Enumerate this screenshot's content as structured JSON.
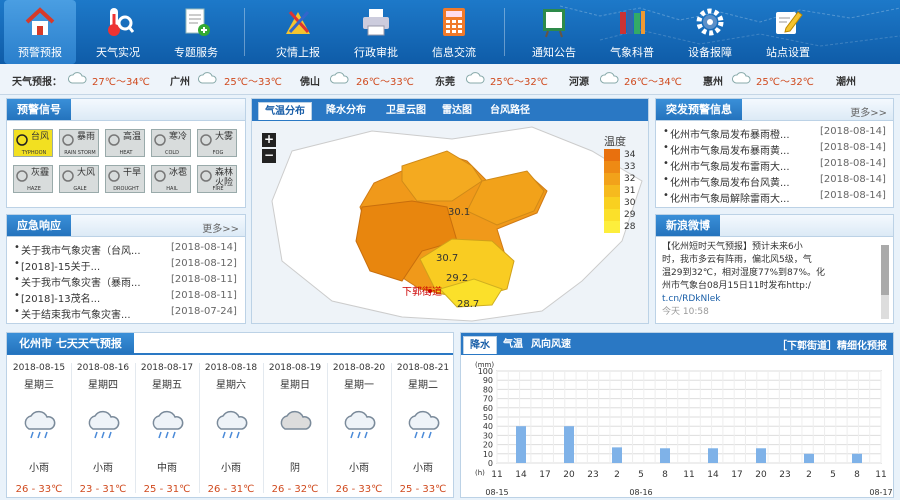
{
  "nav": [
    {
      "label": "预警预报",
      "icon": "home-icon",
      "active": true
    },
    {
      "label": "天气实况",
      "icon": "thermometer-icon",
      "active": false
    },
    {
      "label": "专题服务",
      "icon": "document-icon",
      "active": false
    },
    {
      "label": "灾情上报",
      "icon": "report-icon",
      "active": false
    },
    {
      "label": "行政审批",
      "icon": "printer-icon",
      "active": false
    },
    {
      "label": "信息交流",
      "icon": "calculator-icon",
      "active": false
    },
    {
      "label": "通知公告",
      "icon": "notice-board-icon",
      "active": false
    },
    {
      "label": "气象科普",
      "icon": "books-icon",
      "active": false
    },
    {
      "label": "设备报障",
      "icon": "gear-icon",
      "active": false
    },
    {
      "label": "站点设置",
      "icon": "settings-pen-icon",
      "active": false
    }
  ],
  "ticker": {
    "label": "天气预报：",
    "items": [
      {
        "city": "",
        "temp": "27℃～34℃"
      },
      {
        "city": "广州",
        "temp": "25℃～33℃"
      },
      {
        "city": "佛山",
        "temp": "26℃～33℃"
      },
      {
        "city": "东莞",
        "temp": "25℃～32℃"
      },
      {
        "city": "河源",
        "temp": "26℃～34℃"
      },
      {
        "city": "惠州",
        "temp": "25℃～32℃"
      },
      {
        "city": "潮州",
        "temp": ""
      }
    ]
  },
  "warnings": {
    "title": "预警信号",
    "icons": [
      {
        "name": "typhoon-warning-icon",
        "cn": "台风",
        "en": "TYPHOON",
        "active": true
      },
      {
        "name": "rainstorm-warning-icon",
        "cn": "暴雨",
        "en": "RAIN STORM",
        "active": false
      },
      {
        "name": "heat-warning-icon",
        "cn": "高温",
        "en": "HEAT",
        "active": false
      },
      {
        "name": "cold-warning-icon",
        "cn": "寒冷",
        "en": "COLD",
        "active": false
      },
      {
        "name": "fog-warning-icon",
        "cn": "大雾",
        "en": "FOG",
        "active": false
      },
      {
        "name": "haze-warning-icon",
        "cn": "灰霾",
        "en": "HAZE",
        "active": false
      },
      {
        "name": "gale-warning-icon",
        "cn": "大风",
        "en": "GALE",
        "active": false
      },
      {
        "name": "drought-warning-icon",
        "cn": "干旱",
        "en": "DROUGHT",
        "active": false
      },
      {
        "name": "hail-warning-icon",
        "cn": "冰雹",
        "en": "HAIL",
        "active": false
      },
      {
        "name": "fire-warning-icon",
        "cn": "森林火险",
        "en": "FIRE",
        "active": false
      }
    ]
  },
  "emergency": {
    "title": "应急响应",
    "more": "更多>>",
    "items": [
      {
        "text": "关于我市气象灾害（台风...",
        "date": "[2018-08-14]"
      },
      {
        "text": "[2018]-15关于...",
        "date": "[2018-08-12]"
      },
      {
        "text": "关于我市气象灾害（暴雨...",
        "date": "[2018-08-11]"
      },
      {
        "text": "[2018]-13茂名...",
        "date": "[2018-08-11]"
      },
      {
        "text": "关于结束我市气象灾害...",
        "date": "[2018-07-24]"
      }
    ]
  },
  "map": {
    "tabs": [
      "气温分布",
      "降水分布",
      "卫星云图",
      "雷达图",
      "台风路径"
    ],
    "legend_title": "温度",
    "legend": [
      {
        "value": "34",
        "color": "#e8700e"
      },
      {
        "value": "33",
        "color": "#ee8a14"
      },
      {
        "value": "32",
        "color": "#f2a21a"
      },
      {
        "value": "31",
        "color": "#f6ba1e"
      },
      {
        "value": "30",
        "color": "#f9d020"
      },
      {
        "value": "29",
        "color": "#fbe02a"
      },
      {
        "value": "28",
        "color": "#fdee3c"
      }
    ],
    "labels": [
      "30.1",
      "30.7",
      "29.2",
      "28.7",
      "下郭街道"
    ],
    "zoom_in": "+",
    "zoom_out": "−"
  },
  "sudden": {
    "title": "突发预警信息",
    "more": "更多>>",
    "items": [
      {
        "text": "化州市气象局发布暴雨橙...",
        "date": "[2018-08-14]"
      },
      {
        "text": "化州市气象局发布暴雨黄...",
        "date": "[2018-08-14]"
      },
      {
        "text": "化州市气象局发布雷雨大...",
        "date": "[2018-08-14]"
      },
      {
        "text": "化州市气象局发布台风黄...",
        "date": "[2018-08-14]"
      },
      {
        "text": "化州市气象局解除雷雨大...",
        "date": "[2018-08-14]"
      }
    ]
  },
  "weibo": {
    "title": "新浪微博",
    "lines": [
      "【化州短时天气预报】预计未来6小",
      "时，我市多云有阵雨，偏北风5级，气",
      "温29到32℃，相对湿度77%到87%。化",
      "州市气象台08月15日11时发布http:/",
      "t.cn/RDkNlek"
    ],
    "time": "今天  10:58"
  },
  "forecast": {
    "title": "化州市 七天天气预报",
    "days": [
      {
        "date": "2018-08-15",
        "week": "星期三",
        "icon": "rain-cloud-icon",
        "weather": "小雨",
        "temp": "26 - 33℃"
      },
      {
        "date": "2018-08-16",
        "week": "星期四",
        "icon": "rain-cloud-icon",
        "weather": "小雨",
        "temp": "23 - 31℃"
      },
      {
        "date": "2018-08-17",
        "week": "星期五",
        "icon": "rain-cloud-icon",
        "weather": "中雨",
        "temp": "25 - 31℃"
      },
      {
        "date": "2018-08-18",
        "week": "星期六",
        "icon": "rain-cloud-icon",
        "weather": "小雨",
        "temp": "26 - 31℃"
      },
      {
        "date": "2018-08-19",
        "week": "星期日",
        "icon": "overcast-cloud-icon",
        "weather": "阴",
        "temp": "26 - 32℃"
      },
      {
        "date": "2018-08-20",
        "week": "星期一",
        "icon": "rain-cloud-icon",
        "weather": "小雨",
        "temp": "26 - 33℃"
      },
      {
        "date": "2018-08-21",
        "week": "星期二",
        "icon": "rain-cloud-icon",
        "weather": "小雨",
        "temp": "25 - 33℃"
      }
    ]
  },
  "precip": {
    "tabs": [
      "降水",
      "气温",
      "风向风速"
    ],
    "title": "［下郭街道］精细化预报"
  },
  "chart_data": {
    "type": "bar",
    "ylabel": "(mm)",
    "xlabel": "(h)",
    "ylim": [
      0,
      100
    ],
    "yticks": [
      0,
      10,
      20,
      30,
      40,
      50,
      60,
      70,
      80,
      90,
      100
    ],
    "categories": [
      "11",
      "14",
      "17",
      "20",
      "23",
      "2",
      "5",
      "8",
      "11",
      "14",
      "17",
      "20",
      "23",
      "2",
      "5",
      "8",
      "11"
    ],
    "values": [
      0,
      40,
      0,
      40,
      0,
      17,
      0,
      16,
      0,
      16,
      0,
      16,
      0,
      10,
      0,
      10,
      0
    ],
    "date_labels": [
      {
        "label": "08-15",
        "at": 0
      },
      {
        "label": "08-16",
        "at": 6
      },
      {
        "label": "08-17",
        "at": 16
      }
    ],
    "bar_color": "#7fb2e8"
  }
}
